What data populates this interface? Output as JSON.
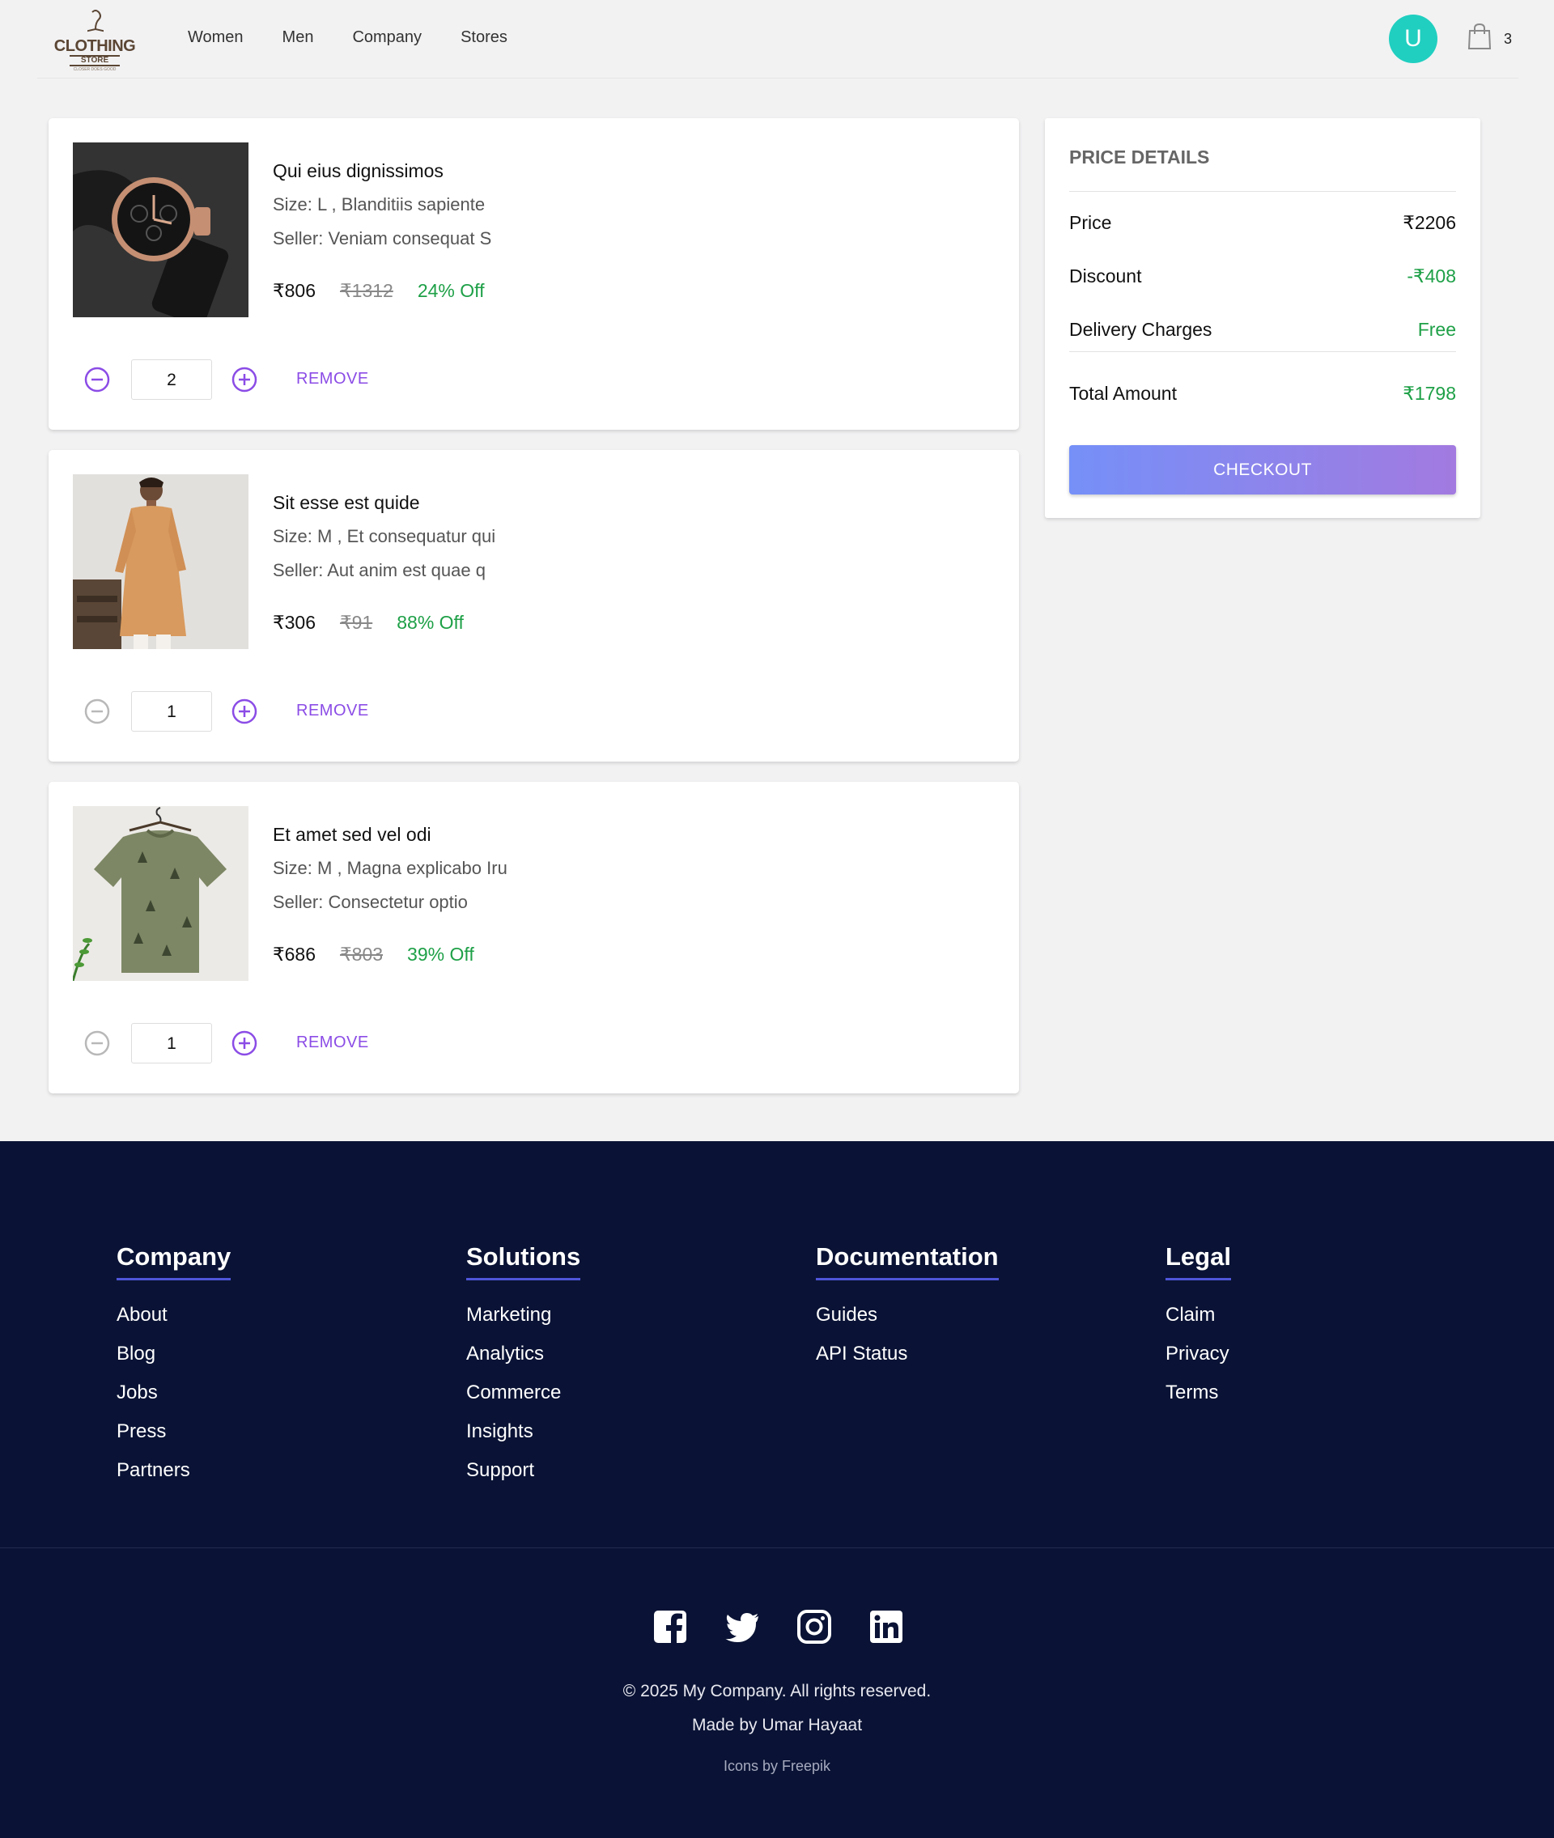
{
  "header": {
    "logo": {
      "brand": "CLOTHING",
      "sub": "STORE",
      "tagline": "CLOSER DOES GOOD"
    },
    "nav": [
      "Women",
      "Men",
      "Company",
      "Stores"
    ],
    "avatar_initial": "U",
    "cart_count": "3"
  },
  "cart": {
    "items": [
      {
        "name": "Qui eius dignissimos",
        "size": "Size: L , Blanditiis sapiente",
        "seller": "Seller: Veniam consequat S",
        "price": "₹806",
        "mrp": "₹1312",
        "discount": "24% Off",
        "quantity": "2",
        "remove_label": "REMOVE",
        "image": "watch"
      },
      {
        "name": "Sit esse est quide",
        "size": "Size: M , Et consequatur qui",
        "seller": "Seller: Aut anim est quae q",
        "price": "₹306",
        "mrp": "₹91",
        "discount": "88% Off",
        "quantity": "1",
        "remove_label": "REMOVE",
        "image": "kurta"
      },
      {
        "name": "Et amet sed vel odi",
        "size": "Size: M , Magna explicabo Iru",
        "seller": "Seller: Consectetur optio",
        "price": "₹686",
        "mrp": "₹803",
        "discount": "39% Off",
        "quantity": "1",
        "remove_label": "REMOVE",
        "image": "tshirt"
      }
    ]
  },
  "price_details": {
    "title": "PRICE DETAILS",
    "price_label": "Price",
    "price_value": "₹2206",
    "discount_label": "Discount",
    "discount_value": "-₹408",
    "delivery_label": "Delivery Charges",
    "delivery_value": "Free",
    "total_label": "Total Amount",
    "total_value": "₹1798",
    "checkout_label": "CHECKOUT"
  },
  "footer": {
    "columns": [
      {
        "title": "Company",
        "links": [
          "About",
          "Blog",
          "Jobs",
          "Press",
          "Partners"
        ]
      },
      {
        "title": "Solutions",
        "links": [
          "Marketing",
          "Analytics",
          "Commerce",
          "Insights",
          "Support"
        ]
      },
      {
        "title": "Documentation",
        "links": [
          "Guides",
          "API Status"
        ]
      },
      {
        "title": "Legal",
        "links": [
          "Claim",
          "Privacy",
          "Terms"
        ]
      }
    ],
    "social": [
      "facebook-icon",
      "twitter-icon",
      "instagram-icon",
      "linkedin-icon"
    ],
    "copyright": "© 2025 My Company. All rights reserved.",
    "made_by": "Made by Umar Hayaat",
    "icons_credit": "Icons by Freepik"
  },
  "colors": {
    "accent": "#8b4ce6",
    "discount_green": "#1ea047",
    "footer_bg": "#0a1335",
    "avatar_bg": "#20cfc0"
  }
}
